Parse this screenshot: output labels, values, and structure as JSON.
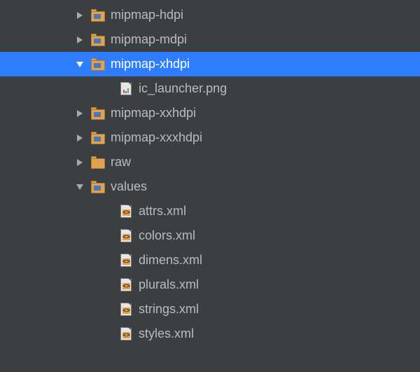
{
  "tree": {
    "mipmap_hdpi": "mipmap-hdpi",
    "mipmap_mdpi": "mipmap-mdpi",
    "mipmap_xhdpi": "mipmap-xhdpi",
    "ic_launcher": "ic_launcher.png",
    "mipmap_xxhdpi": "mipmap-xxhdpi",
    "mipmap_xxxhdpi": "mipmap-xxxhdpi",
    "raw": "raw",
    "values": "values",
    "attrs_xml": "attrs.xml",
    "colors_xml": "colors.xml",
    "dimens_xml": "dimens.xml",
    "plurals_xml": "plurals.xml",
    "strings_xml": "strings.xml",
    "styles_xml": "styles.xml"
  },
  "colors": {
    "selection": "#2f7dff",
    "folder": "#e2a14f",
    "background": "#3c3f41"
  }
}
